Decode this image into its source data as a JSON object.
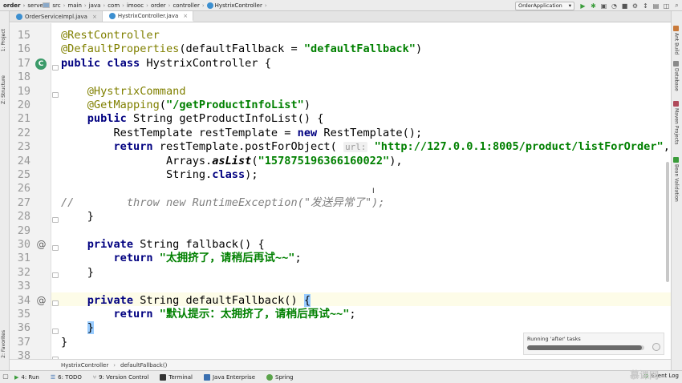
{
  "breadcrumbs": [
    "order",
    "server",
    "src",
    "main",
    "java",
    "com",
    "imooc",
    "order",
    "controller",
    "HystrixController"
  ],
  "run_config": "OrderApplication",
  "tabs": [
    {
      "label": "OrderServiceImpl.java",
      "active": false
    },
    {
      "label": "HystrixController.java",
      "active": true
    }
  ],
  "left_tabs": [
    "1: Project",
    "Z: Structure",
    "2: Favorites"
  ],
  "right_tabs": [
    "Ant Build",
    "Database",
    "Maven Projects",
    "Bean Validation"
  ],
  "lines": [
    {
      "num": "15",
      "code": "@RestController"
    },
    {
      "num": "16",
      "code": "@DefaultProperties(defaultFallback = \"defaultFallback\")"
    },
    {
      "num": "17",
      "code": "public class HystrixController {"
    },
    {
      "num": "18",
      "code": ""
    },
    {
      "num": "19",
      "code": "    @HystrixCommand"
    },
    {
      "num": "20",
      "code": "    @GetMapping(\"/getProductInfoList\")"
    },
    {
      "num": "21",
      "code": "    public String getProductInfoList() {"
    },
    {
      "num": "22",
      "code": "        RestTemplate restTemplate = new RestTemplate();"
    },
    {
      "num": "23",
      "code": "        return restTemplate.postForObject( url: \"http://127.0.0.1:8005/product/listForOrder\","
    },
    {
      "num": "24",
      "code": "                Arrays.asList(\"157875196366160022\"),"
    },
    {
      "num": "25",
      "code": "                String.class);"
    },
    {
      "num": "26",
      "code": ""
    },
    {
      "num": "27",
      "code": "//        throw new RuntimeException(\"发送异常了\");"
    },
    {
      "num": "28",
      "code": "    }"
    },
    {
      "num": "29",
      "code": ""
    },
    {
      "num": "30",
      "code": "    private String fallback() {"
    },
    {
      "num": "31",
      "code": "        return \"太拥挤了，请稍后再试~~\";"
    },
    {
      "num": "32",
      "code": "    }"
    },
    {
      "num": "33",
      "code": ""
    },
    {
      "num": "34",
      "code": "    private String defaultFallback() {"
    },
    {
      "num": "35",
      "code": "        return \"默认提示：太拥挤了，请稍后再试~~\";"
    },
    {
      "num": "36",
      "code": "    }"
    },
    {
      "num": "37",
      "code": "}"
    },
    {
      "num": "38",
      "code": ""
    }
  ],
  "code_parts": {
    "l15": "@RestController",
    "l16_an": "@DefaultProperties",
    "l16_rest": "(defaultFallback = ",
    "l16_str": "\"defaultFallback\"",
    "l16_end": ")",
    "l17_kw": "public class",
    "l17_rest": " HystrixController {",
    "l19": "@HystrixCommand",
    "l20_an": "@GetMapping",
    "l20_open": "(",
    "l20_str": "\"/getProductInfoList\"",
    "l20_end": ")",
    "l21_kw": "public",
    "l21_rest": " String getProductInfoList() {",
    "l22_a": "RestTemplate restTemplate = ",
    "l22_kw": "new",
    "l22_b": " RestTemplate();",
    "l23_kw": "return",
    "l23_a": " restTemplate.postForObject(",
    "l23_hint": "url:",
    "l23_str": "\"http://127.0.0.1:8005/product/listForOrder\"",
    "l23_end": ",",
    "l24_a": "Arrays.",
    "l24_m": "asList",
    "l24_open": "(",
    "l24_str": "\"157875196366160022\"",
    "l24_end": "),",
    "l25_a": "String.",
    "l25_kw": "class",
    "l25_end": ");",
    "l27": "//        throw new RuntimeException(\"发送异常了\");",
    "l28": "}",
    "l30_kw": "private",
    "l30_rest": " String fallback() {",
    "l31_kw": "return",
    "l31_str": " \"太拥挤了，请稍后再试~~\"",
    "l31_end": ";",
    "l32": "}",
    "l34_kw": "private",
    "l34_rest": " String defaultFallback() ",
    "l34_brace": "{",
    "l35_kw": "return",
    "l35_str": " \"默认提示：太拥挤了，请稍后再试~~\"",
    "l35_end": ";",
    "l36": "}",
    "l37": "}"
  },
  "progress": {
    "label": "Running 'after' tasks",
    "fraction": 0.98
  },
  "bottom_breadcrumb": [
    "HystrixController",
    "defaultFallback()"
  ],
  "status_items": [
    "4: Run",
    "6: TODO",
    "9: Version Control",
    "Terminal",
    "Java Enterprise",
    "Spring"
  ],
  "event_log": "Event Log",
  "watermark": "慕课网",
  "colors": {
    "keyword": "#000080",
    "annotation": "#808000",
    "string": "#008000",
    "comment": "#808080"
  }
}
